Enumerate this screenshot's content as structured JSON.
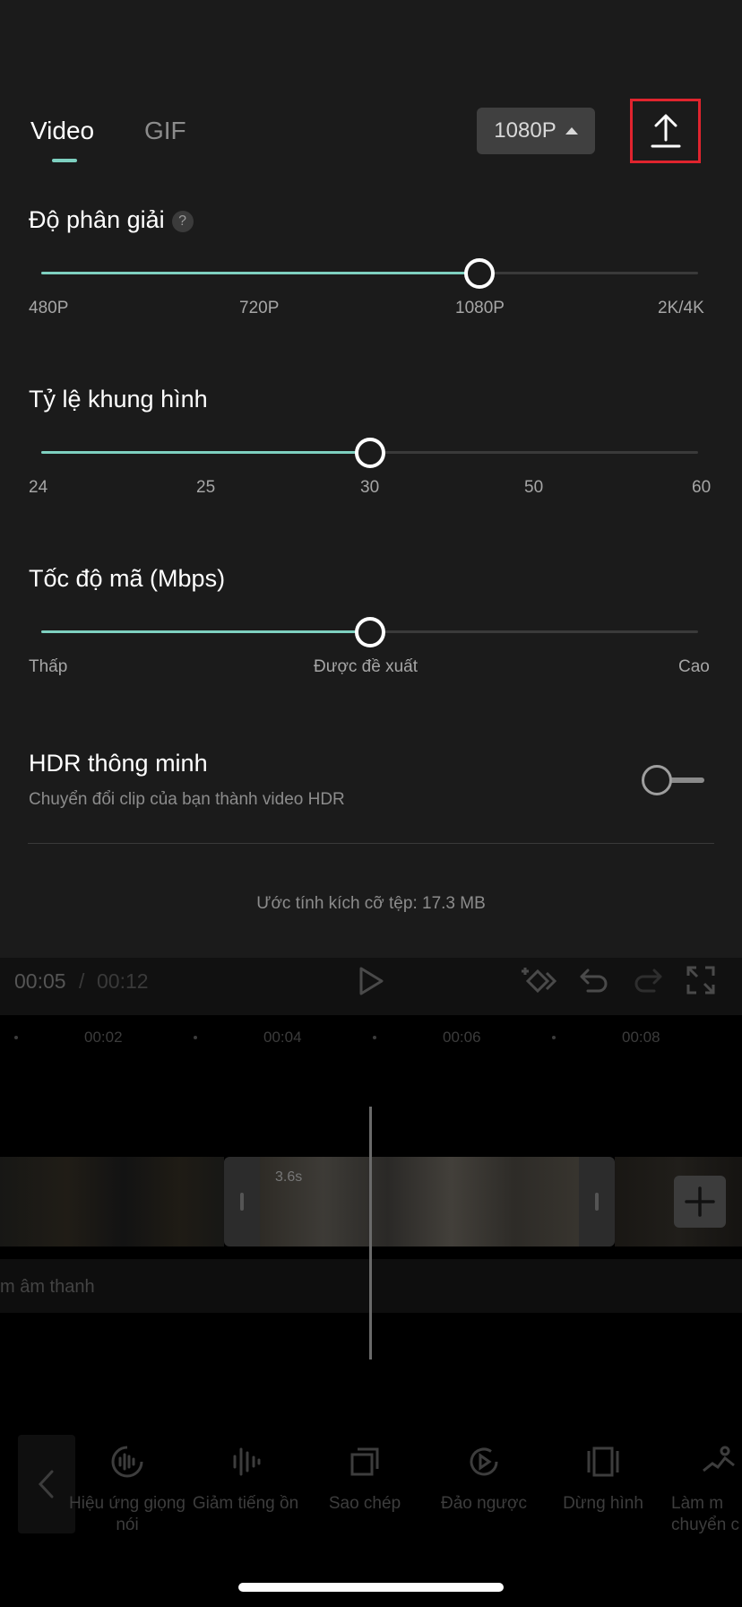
{
  "tabs": {
    "video": "Video",
    "gif": "GIF"
  },
  "resolution_pill": {
    "label": "1080P"
  },
  "resolution": {
    "title": "Độ phân giải",
    "help": "?",
    "ticks": [
      "480P",
      "720P",
      "1080P",
      "2K/4K"
    ],
    "selected_fraction": 0.667
  },
  "frame_rate": {
    "title": "Tỷ lệ khung hình",
    "ticks": [
      "24",
      "25",
      "30",
      "50",
      "60"
    ],
    "selected_fraction": 0.5
  },
  "bitrate": {
    "title": "Tốc độ mã (Mbps)",
    "ticks": [
      "Thấp",
      "Được đề xuất",
      "Cao"
    ],
    "selected_fraction": 0.5
  },
  "hdr": {
    "title": "HDR thông minh",
    "subtitle": "Chuyển đổi clip của bạn thành video HDR",
    "enabled": false
  },
  "file_size": "Ước tính kích cỡ tệp: 17.3 MB",
  "editor": {
    "current_time": "00:05",
    "separator": "/",
    "total_time": "00:12",
    "ruler": [
      "00:02",
      "00:04",
      "00:06",
      "00:08"
    ],
    "clip_duration": "3.6s",
    "audio_label": "m âm thanh"
  },
  "tools": [
    {
      "icon": "voice-effect-icon",
      "label": "Hiệu ứng giọng nói"
    },
    {
      "icon": "noise-reduction-icon",
      "label": "Giảm tiếng ồn"
    },
    {
      "icon": "copy-icon",
      "label": "Sao chép"
    },
    {
      "icon": "reverse-icon",
      "label": "Đảo ngược"
    },
    {
      "icon": "freeze-icon",
      "label": "Dừng hình"
    },
    {
      "icon": "motion-icon",
      "label": "Làm m chuyển c"
    }
  ],
  "colors": {
    "accent": "#7ed0c0",
    "highlight_border": "#e0242e",
    "panel_bg": "#1b1b1b"
  }
}
